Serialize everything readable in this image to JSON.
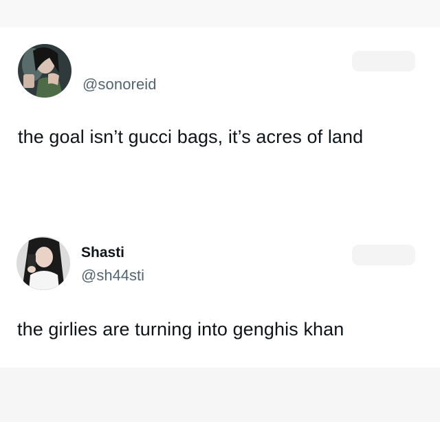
{
  "tweets": [
    {
      "handle": "@sonoreid",
      "text": "the goal isn’t gucci bags, it’s acres of land"
    },
    {
      "display_name": "Shasti",
      "handle": "@sh44sti",
      "text": "the girlies are turning into genghis khan"
    }
  ],
  "colors": {
    "text": "#0f1419",
    "handle": "#536471",
    "background": "#ffffff"
  }
}
